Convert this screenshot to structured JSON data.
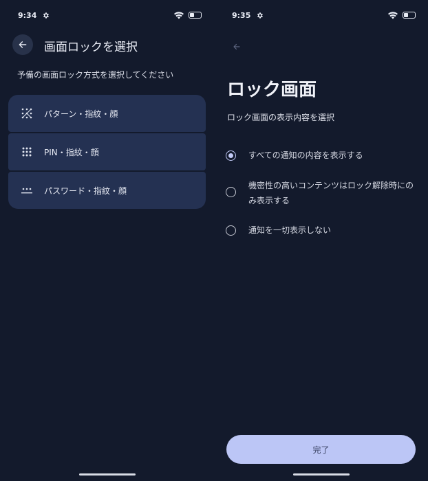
{
  "left": {
    "status": {
      "time": "9:34"
    },
    "title": "画面ロックを選択",
    "subtitle": "予備の画面ロック方式を選択してください",
    "options": [
      {
        "label": "パターン・指紋・顔",
        "icon": "pattern-icon"
      },
      {
        "label": "PIN・指紋・顔",
        "icon": "pin-dots-icon"
      },
      {
        "label": "パスワード・指紋・顔",
        "icon": "password-icon"
      }
    ]
  },
  "right": {
    "status": {
      "time": "9:35"
    },
    "title": "ロック画面",
    "section": "ロック画面の表示内容を選択",
    "radios": [
      {
        "label": "すべての通知の内容を表示する",
        "checked": true
      },
      {
        "label": "機密性の高いコンテンツはロック解除時にのみ表示する",
        "checked": false
      },
      {
        "label": "通知を一切表示しない",
        "checked": false
      }
    ],
    "done_label": "完了"
  },
  "colors": {
    "background": "#131a2c",
    "card": "#243152",
    "accent": "#bcc6f6"
  }
}
